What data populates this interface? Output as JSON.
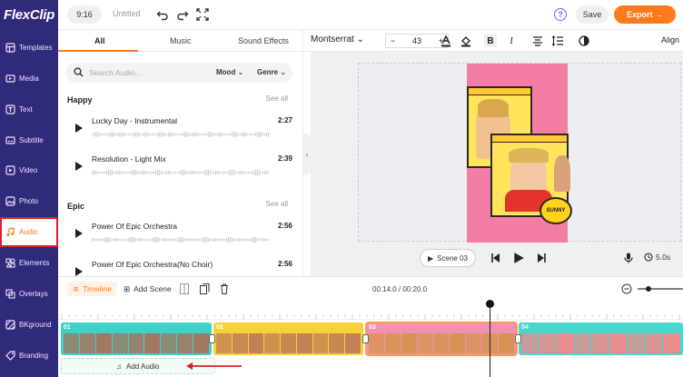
{
  "app": {
    "logo": "FlexClip"
  },
  "sidebar": {
    "items": [
      {
        "label": "Templates",
        "icon": "templates-icon"
      },
      {
        "label": "Media",
        "icon": "media-icon"
      },
      {
        "label": "Text",
        "icon": "text-icon"
      },
      {
        "label": "Subtitle",
        "icon": "subtitle-icon"
      },
      {
        "label": "Video",
        "icon": "video-icon"
      },
      {
        "label": "Photo",
        "icon": "photo-icon"
      },
      {
        "label": "Audio",
        "icon": "music-note-icon",
        "active": true
      },
      {
        "label": "Elements",
        "icon": "elements-icon"
      },
      {
        "label": "Overlays",
        "icon": "overlays-icon"
      },
      {
        "label": "BKground",
        "icon": "background-icon"
      },
      {
        "label": "Branding",
        "icon": "branding-icon"
      }
    ]
  },
  "topbar": {
    "aspect_ratio": "9:16",
    "doc_title": "Untitled",
    "save_label": "Save",
    "export_label": "Export →",
    "help": "?"
  },
  "panel": {
    "tabs": [
      "All",
      "Music",
      "Sound Effects"
    ],
    "active_tab": "All",
    "search_placeholder": "Search Audio...",
    "filters": [
      "Mood",
      "Genre"
    ],
    "sections": [
      {
        "title": "Happy",
        "see_all": "See all",
        "tracks": [
          {
            "name": "Lucky Day - Instrumental",
            "duration": "2:27"
          },
          {
            "name": "Resolution - Light Mix",
            "duration": "2:39"
          }
        ]
      },
      {
        "title": "Epic",
        "see_all": "See all",
        "tracks": [
          {
            "name": "Power Of Epic Orchestra",
            "duration": "2:56"
          },
          {
            "name": "Power Of Epic Orchestra(No Choir)",
            "duration": "2:56"
          }
        ]
      }
    ]
  },
  "texttools": {
    "font": "Montserrat",
    "font_size": "43",
    "minus": "−",
    "plus": "+",
    "bold": "B",
    "italic": "I",
    "align_label": "Align"
  },
  "canvas": {
    "sticker_text": "SUNNY",
    "scene_label": "Scene 03",
    "duration": "5.0s"
  },
  "timeline": {
    "timeline_label": "Timeline",
    "add_scene_label": "Add Scene",
    "timecode": "00:14.0 / 00:20.0",
    "add_audio_label": "Add Audio",
    "clips": [
      {
        "num": "01",
        "color": "#3fd1c8",
        "thumb": "#a6745e"
      },
      {
        "num": "02",
        "color": "#f5d23a",
        "thumb": "#c07b55"
      },
      {
        "num": "03",
        "color": "#f58fb0",
        "thumb": "#d6934f",
        "selected": true
      },
      {
        "num": "04",
        "color": "#47d5cc",
        "thumb": "#f18a8a"
      }
    ]
  },
  "colors": {
    "sidebar": "#2f2a7a",
    "accent": "#ff7a1a",
    "highlight": "#e01b24"
  }
}
